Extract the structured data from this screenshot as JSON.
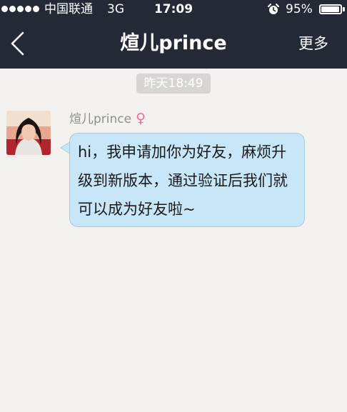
{
  "status_bar": {
    "carrier": "中国联通",
    "network": "3G",
    "time": "17:09",
    "battery": "95%",
    "battery_level": 0.95,
    "alarm_icon": "alarm-clock-icon"
  },
  "nav": {
    "back_icon": "chevron-left-icon",
    "title": "煊儿prince",
    "more_label": "更多"
  },
  "chat": {
    "timestamp": "昨天18:49",
    "messages": [
      {
        "sender": "煊儿prince",
        "gender_icon": "♀",
        "text": "hi，我申请加你为好友，麻烦升级到新版本，通过验证后我们就可以成为好友啦~"
      }
    ]
  },
  "colors": {
    "header_bg": "#232a35",
    "chat_bg": "#f4f2ef",
    "bubble_bg": "#c7e6f8",
    "gender_female": "#ef6a9b"
  }
}
